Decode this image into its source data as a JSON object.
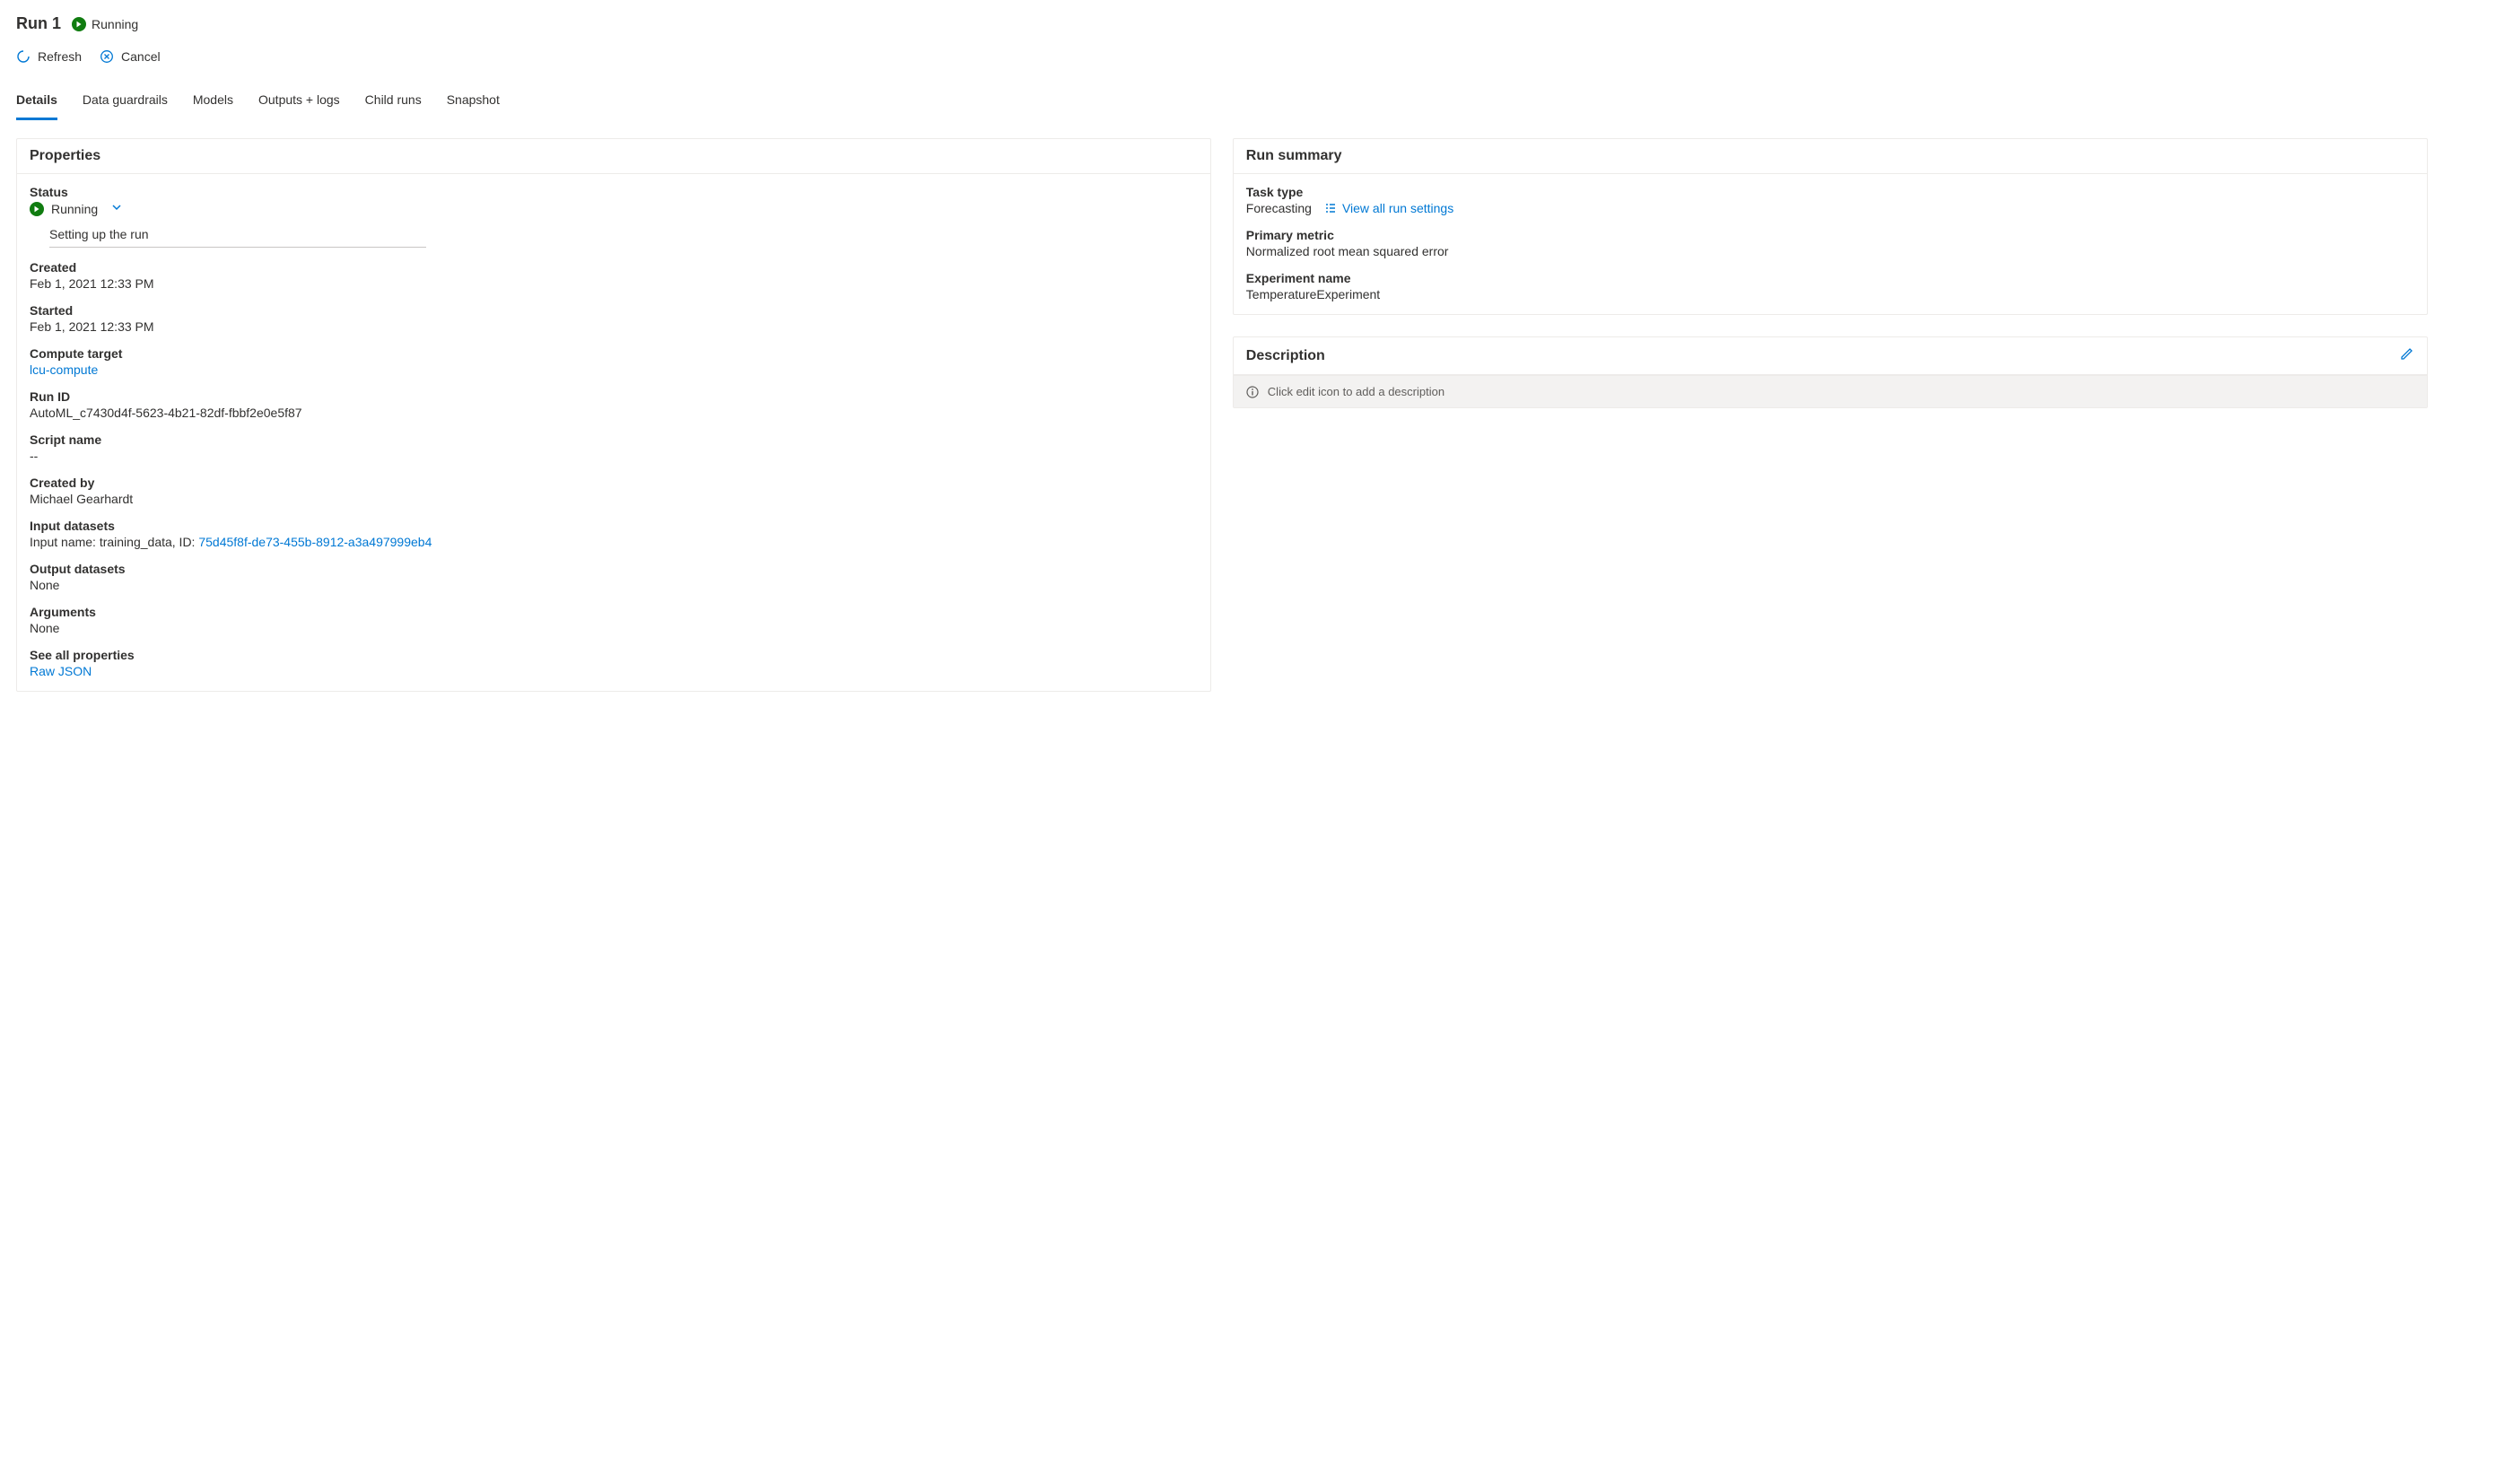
{
  "header": {
    "title": "Run 1",
    "status": "Running"
  },
  "toolbar": {
    "refresh": "Refresh",
    "cancel": "Cancel"
  },
  "tabs": {
    "details": "Details",
    "guardrails": "Data guardrails",
    "models": "Models",
    "outputs": "Outputs + logs",
    "child": "Child runs",
    "snapshot": "Snapshot"
  },
  "properties": {
    "card_title": "Properties",
    "status_label": "Status",
    "status_value": "Running",
    "sub_status": "Setting up the run",
    "created_label": "Created",
    "created_value": "Feb 1, 2021 12:33 PM",
    "started_label": "Started",
    "started_value": "Feb 1, 2021 12:33 PM",
    "compute_label": "Compute target",
    "compute_value": "lcu-compute",
    "runid_label": "Run ID",
    "runid_value": "AutoML_c7430d4f-5623-4b21-82df-fbbf2e0e5f87",
    "script_label": "Script name",
    "script_value": "--",
    "createdby_label": "Created by",
    "createdby_value": "Michael Gearhardt",
    "inputds_label": "Input datasets",
    "inputds_prefix": "Input name: training_data, ID: ",
    "inputds_id": "75d45f8f-de73-455b-8912-a3a497999eb4",
    "outputds_label": "Output datasets",
    "outputds_value": "None",
    "args_label": "Arguments",
    "args_value": "None",
    "seeall_label": "See all properties",
    "seeall_link": "Raw JSON"
  },
  "summary": {
    "card_title": "Run summary",
    "task_label": "Task type",
    "task_value": "Forecasting",
    "view_settings": "View all run settings",
    "metric_label": "Primary metric",
    "metric_value": "Normalized root mean squared error",
    "exp_label": "Experiment name",
    "exp_value": "TemperatureExperiment"
  },
  "description": {
    "card_title": "Description",
    "placeholder": "Click edit icon to add a description"
  }
}
